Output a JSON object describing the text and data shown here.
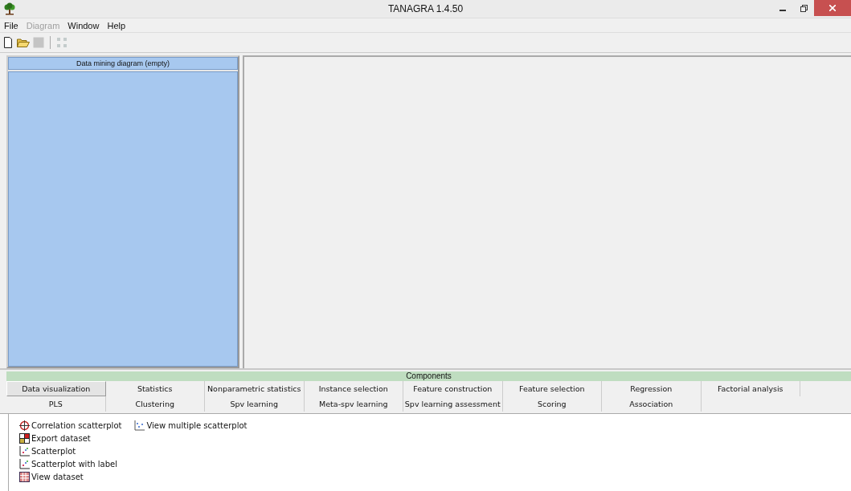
{
  "window": {
    "title": "TANAGRA 1.4.50"
  },
  "menu": [
    {
      "label": "File",
      "disabled": false
    },
    {
      "label": "Diagram",
      "disabled": true
    },
    {
      "label": "Window",
      "disabled": false
    },
    {
      "label": "Help",
      "disabled": false
    }
  ],
  "toolbar": [
    {
      "kind": "new",
      "disabled": false
    },
    {
      "kind": "open",
      "disabled": false
    },
    {
      "kind": "save",
      "disabled": true
    },
    {
      "kind": "separator"
    },
    {
      "kind": "diagram",
      "disabled": true
    }
  ],
  "diagram_panel": {
    "title": "Data mining diagram (empty)"
  },
  "components": {
    "title": "Components",
    "tab_rows": [
      [
        {
          "label": "Data visualization",
          "selected": true
        },
        {
          "label": "Statistics",
          "selected": false
        },
        {
          "label": "Nonparametric statistics",
          "selected": false
        },
        {
          "label": "Instance selection",
          "selected": false
        },
        {
          "label": "Feature construction",
          "selected": false
        },
        {
          "label": "Feature selection",
          "selected": false
        },
        {
          "label": "Regression",
          "selected": false
        },
        {
          "label": "Factorial analysis",
          "selected": false
        }
      ],
      [
        {
          "label": "PLS",
          "selected": false
        },
        {
          "label": "Clustering",
          "selected": false
        },
        {
          "label": "Spv learning",
          "selected": false
        },
        {
          "label": "Meta-spv learning",
          "selected": false
        },
        {
          "label": "Spv learning assessment",
          "selected": false
        },
        {
          "label": "Scoring",
          "selected": false
        },
        {
          "label": "Association",
          "selected": false
        }
      ]
    ],
    "columns": [
      [
        {
          "label": "Correlation scatterplot",
          "kind": "correlation"
        },
        {
          "label": "Export dataset",
          "kind": "export"
        },
        {
          "label": "Scatterplot",
          "kind": "scatter"
        },
        {
          "label": "Scatterplot with label",
          "kind": "scatter"
        },
        {
          "label": "View dataset",
          "kind": "view"
        }
      ],
      [
        {
          "label": "View multiple scatterplot",
          "kind": "multi"
        }
      ]
    ]
  }
}
